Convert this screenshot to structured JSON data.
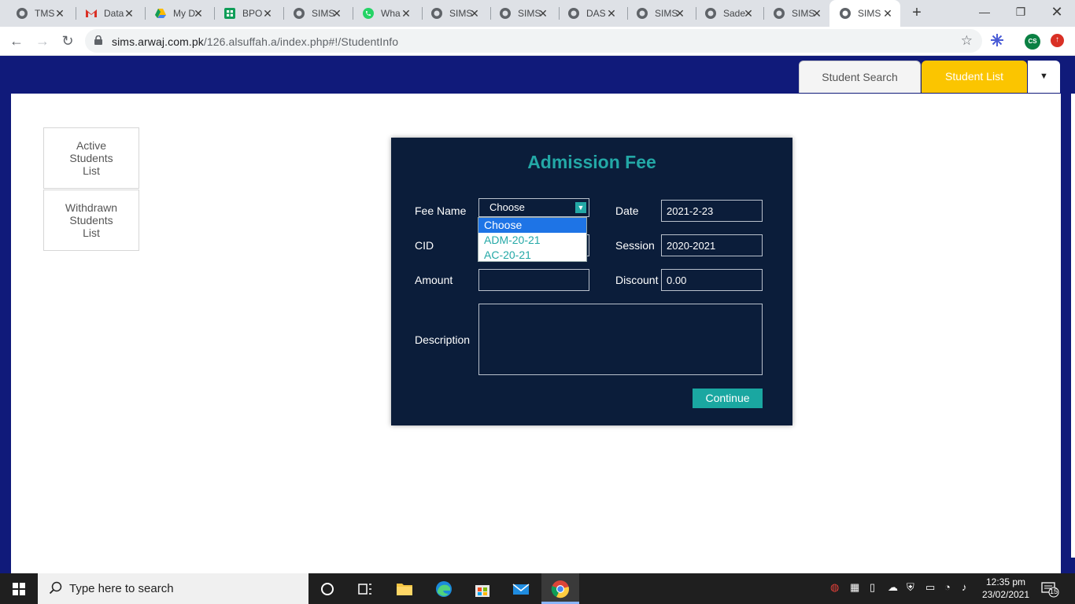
{
  "browser": {
    "tabs": [
      {
        "title": "TMS",
        "icon": "globe-icon"
      },
      {
        "title": "Data",
        "icon": "gmail-icon"
      },
      {
        "title": "My D",
        "icon": "drive-icon"
      },
      {
        "title": "BPO",
        "icon": "sheets-icon"
      },
      {
        "title": "SIMS",
        "icon": "globe-icon"
      },
      {
        "title": "Wha",
        "icon": "whatsapp-icon"
      },
      {
        "title": "SIMS",
        "icon": "globe-icon"
      },
      {
        "title": "SIMS",
        "icon": "globe-icon"
      },
      {
        "title": "DAS",
        "icon": "globe-icon"
      },
      {
        "title": "SIMS",
        "icon": "globe-icon"
      },
      {
        "title": "Sade",
        "icon": "globe-icon"
      },
      {
        "title": "SIMS",
        "icon": "globe-icon"
      },
      {
        "title": "SIMS",
        "icon": "globe-icon"
      }
    ],
    "new_tab": "+",
    "url_domain": "sims.arwaj.com.pk",
    "url_path": "/126.alsuffah.a/index.php#!/StudentInfo",
    "profile_initials": "CS"
  },
  "page": {
    "tabs": {
      "student_search": "Student Search",
      "student_list": "Student List"
    },
    "sidebar": {
      "active": "Active Students List",
      "withdrawn": "Withdrawn Students List"
    }
  },
  "modal": {
    "title": "Admission Fee",
    "fee_name_label": "Fee Name",
    "fee_name_selected": "Choose",
    "fee_options": [
      "Choose",
      "ADM-20-21",
      "AC-20-21"
    ],
    "cid_label": "CID",
    "amount_label": "Amount",
    "amount_value": "",
    "description_label": "Description",
    "description_value": "",
    "date_label": "Date",
    "date_value": "2021-2-23",
    "session_label": "Session",
    "session_value": "2020-2021",
    "discount_label": "Discount",
    "discount_value": "0.00",
    "continue_label": "Continue"
  },
  "taskbar": {
    "search_placeholder": "Type here to search",
    "time": "12:35 pm",
    "date": "23/02/2021",
    "notification_count": "15"
  },
  "colors": {
    "header_navy": "#101a7a",
    "modal_bg": "#0b1d3a",
    "teal_accent": "#23a8a6",
    "active_tab_yellow": "#fbc500"
  }
}
